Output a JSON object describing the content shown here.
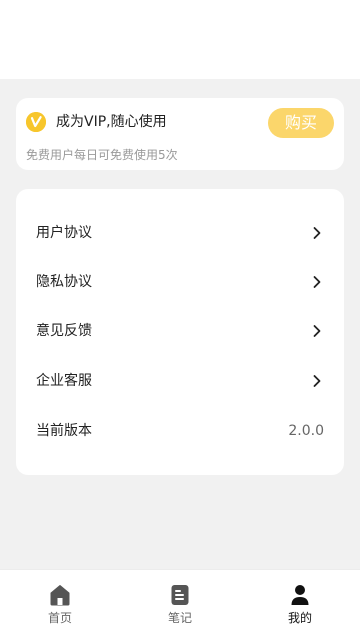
{
  "vip": {
    "title": "成为VIP,随心使用",
    "buy_label": "购买",
    "subtitle": "免费用户每日可免费使用5次",
    "icon": "vip-badge-icon",
    "accent_color": "#f7c62c",
    "button_color": "#fbd66b"
  },
  "menu": {
    "items": [
      {
        "label": "用户协议",
        "icon": "chevron-right-icon"
      },
      {
        "label": "隐私协议",
        "icon": "chevron-right-icon"
      },
      {
        "label": "意见反馈",
        "icon": "chevron-right-icon"
      },
      {
        "label": "企业客服",
        "icon": "chevron-right-icon"
      }
    ],
    "version": {
      "label": "当前版本",
      "value": "2.0.0"
    }
  },
  "tabbar": {
    "tabs": [
      {
        "label": "首页",
        "icon": "home-icon",
        "active": false
      },
      {
        "label": "笔记",
        "icon": "notes-icon",
        "active": false
      },
      {
        "label": "我的",
        "icon": "profile-icon",
        "active": true
      }
    ]
  }
}
